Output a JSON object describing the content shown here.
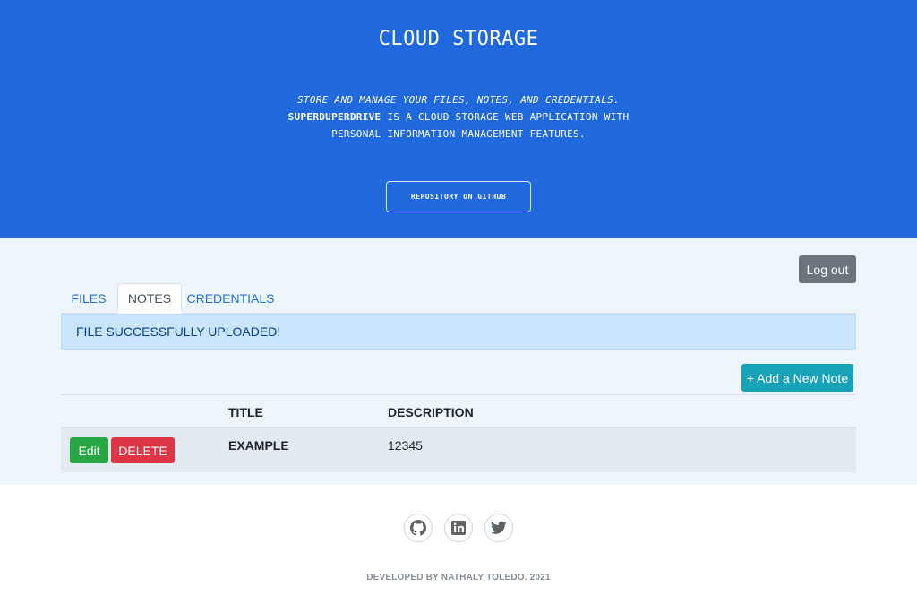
{
  "hero": {
    "title": "CLOUD STORAGE",
    "tagline": "STORE AND MANAGE YOUR FILES, NOTES, AND CREDENTIALS.",
    "brand": "SUPERDUPERDRIVE",
    "description_rest": " IS A CLOUD STORAGE WEB APPLICATION WITH",
    "description_line3": "PERSONAL INFORMATION MANAGEMENT FEATURES.",
    "repo_button": "REPOSITORY ON GITHUB",
    "background_color": "#1f69dd"
  },
  "main": {
    "logout_label": "Log out",
    "tabs": [
      {
        "label": "FILES",
        "active": false
      },
      {
        "label": "NOTES",
        "active": true
      },
      {
        "label": "CREDENTIALS",
        "active": false
      }
    ],
    "alert": "FILE SUCCESSFULLY UPLOADED!",
    "add_note_label": "+ Add a New Note",
    "table": {
      "headers": [
        "",
        "TITLE",
        "DESCRIPTION"
      ],
      "rows": [
        {
          "edit_label": "Edit",
          "delete_label": "DELETE",
          "title": "EXAMPLE",
          "description": "12345"
        }
      ]
    }
  },
  "footer": {
    "social_icons": [
      "github-icon",
      "linkedin-icon",
      "twitter-icon"
    ],
    "credit": "DEVELOPED BY NATHALY TOLEDO. 2021"
  }
}
